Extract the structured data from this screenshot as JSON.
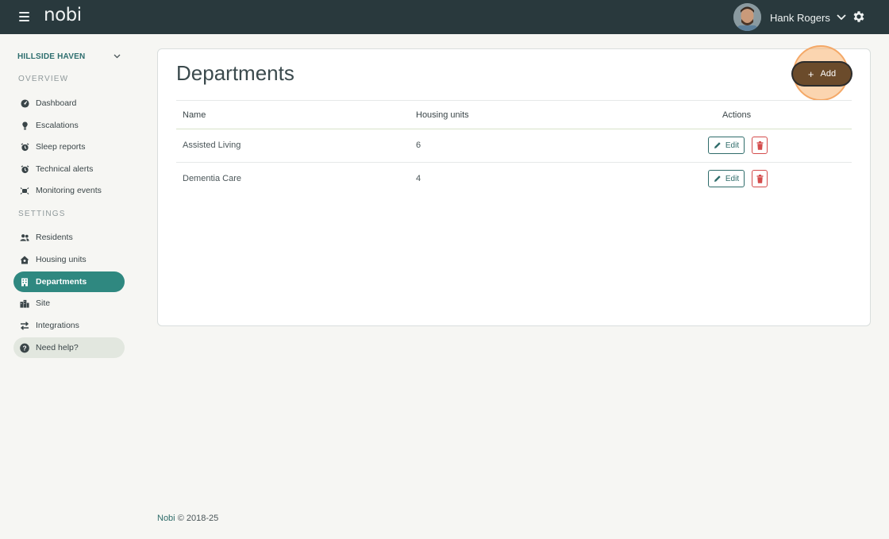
{
  "app": {
    "logo": "nobi"
  },
  "topbar": {
    "user_name": "Hank Rogers"
  },
  "sidebar": {
    "site_name": "HILLSIDE HAVEN",
    "sections": [
      {
        "label": "OVERVIEW"
      },
      {
        "label": "SETTINGS"
      }
    ],
    "items": [
      {
        "label": "Dashboard",
        "icon": "dashboard-icon"
      },
      {
        "label": "Escalations",
        "icon": "escalation-icon"
      },
      {
        "label": "Sleep reports",
        "icon": "alarm-clock-icon"
      },
      {
        "label": "Technical alerts",
        "icon": "alarm-clock-icon"
      },
      {
        "label": "Monitoring events",
        "icon": "monitoring-icon"
      },
      {
        "label": "Residents",
        "icon": "people-icon"
      },
      {
        "label": "Housing units",
        "icon": "house-icon"
      },
      {
        "label": "Departments",
        "icon": "building-icon",
        "active": true
      },
      {
        "label": "Site",
        "icon": "city-icon"
      },
      {
        "label": "Integrations",
        "icon": "arrows-icon"
      },
      {
        "label": "Need help?",
        "icon": "question-icon"
      }
    ]
  },
  "main": {
    "title": "Departments",
    "add_label": "Add",
    "columns": [
      "Name",
      "Housing units",
      "Actions"
    ],
    "rows": [
      {
        "name": "Assisted Living",
        "housing_units": "6"
      },
      {
        "name": "Dementia Care",
        "housing_units": "4"
      }
    ],
    "edit_label": "Edit"
  },
  "footer": {
    "brand": "Nobi",
    "copyright": "© 2018-25"
  },
  "colors": {
    "topbar": "#29393d",
    "accent": "#2f8880",
    "add_button": "#6b4b2b",
    "highlight": "#f4a867",
    "delete": "#d44c4c"
  }
}
